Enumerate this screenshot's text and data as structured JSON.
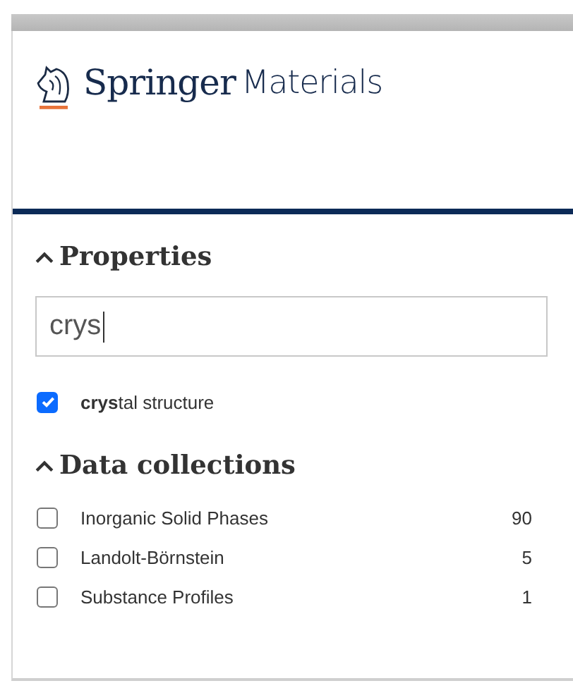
{
  "logo": {
    "brand": "Springer",
    "product": "Materials"
  },
  "sections": [
    {
      "title": "Properties",
      "expanded": true,
      "search": {
        "value": "crys"
      },
      "options": [
        {
          "label": "**crys**tal structure",
          "checked": true
        }
      ]
    },
    {
      "title": "Data collections",
      "expanded": true,
      "options": [
        {
          "label": "Inorganic Solid Phases",
          "count": "90",
          "checked": false
        },
        {
          "label": "Landolt-Börnstein",
          "count": "5",
          "checked": false
        },
        {
          "label": "Substance Profiles",
          "count": "1",
          "checked": false
        }
      ]
    }
  ]
}
